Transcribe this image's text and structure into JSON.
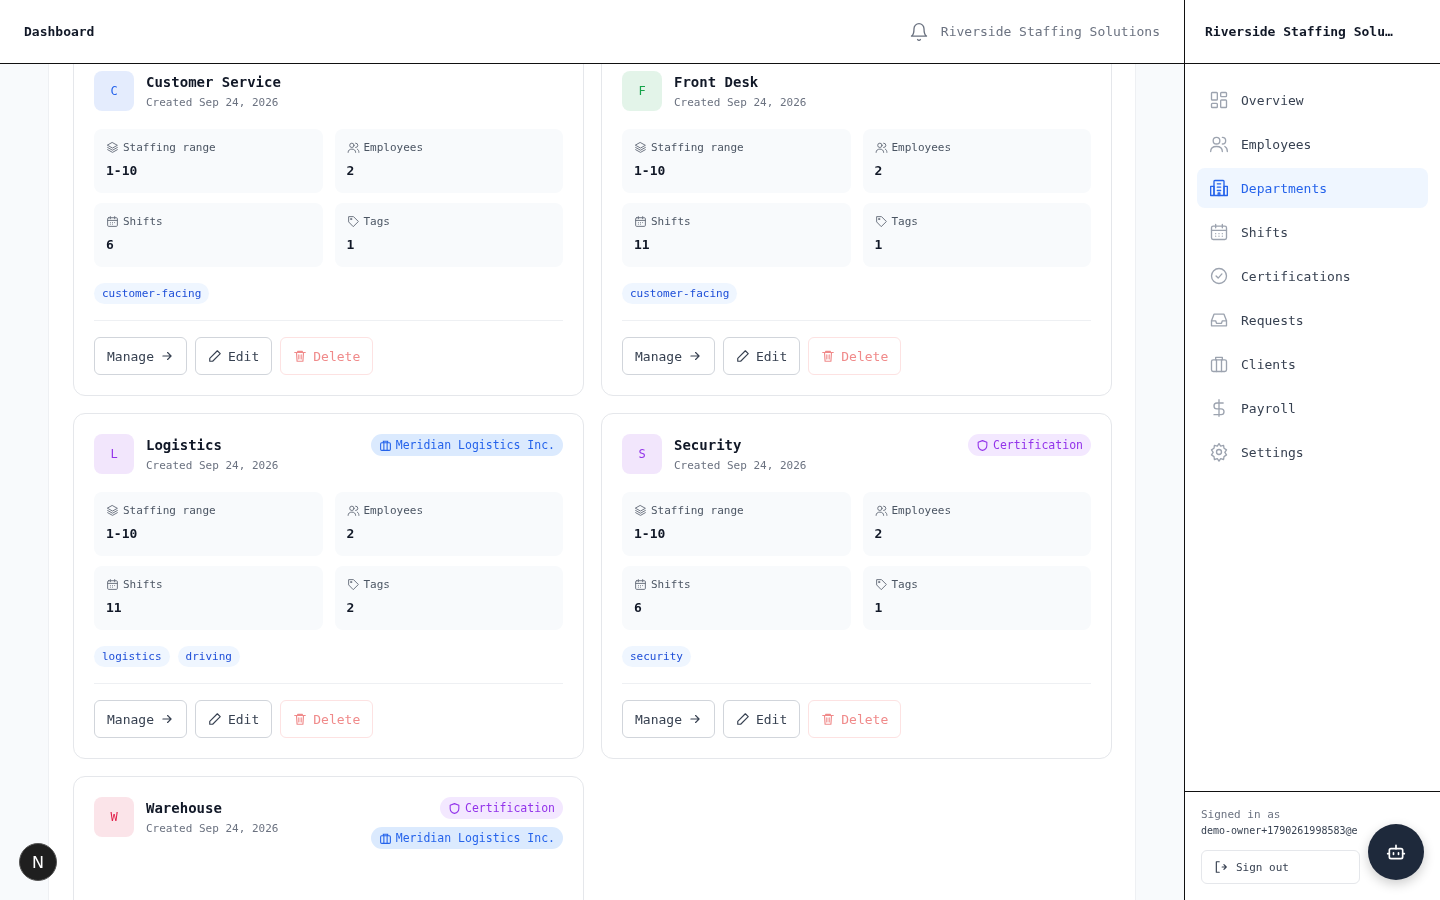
{
  "header": {
    "title": "Dashboard",
    "org": "Riverside Staffing Solutions"
  },
  "departments": [
    {
      "initial": "C",
      "color": "#2563eb",
      "name": "Customer Service",
      "created": "Created Sep 24, 2026",
      "stats": [
        {
          "label": "Staffing range",
          "value": "1-10"
        },
        {
          "label": "Employees",
          "value": "2"
        },
        {
          "label": "Shifts",
          "value": "6"
        },
        {
          "label": "Tags",
          "value": "1"
        }
      ],
      "tags": [
        "customer-facing"
      ],
      "actions": [
        "Manage",
        "Edit",
        "Delete"
      ]
    },
    {
      "initial": "F",
      "color": "#16a34a",
      "name": "Front Desk",
      "created": "Created Sep 24, 2026",
      "stats": [
        {
          "label": "Staffing range",
          "value": "1-10"
        },
        {
          "label": "Employees",
          "value": "2"
        },
        {
          "label": "Shifts",
          "value": "11"
        },
        {
          "label": "Tags",
          "value": "1"
        }
      ],
      "tags": [
        "customer-facing"
      ],
      "actions": [
        "Manage",
        "Edit",
        "Delete"
      ]
    },
    {
      "initial": "L",
      "color": "#9333ea",
      "name": "Logistics",
      "created": "Created Sep 24, 2026",
      "badges": [
        {
          "kind": "client",
          "label": "Meridian Logistics Inc."
        }
      ],
      "stats": [
        {
          "label": "Staffing range",
          "value": "1-10"
        },
        {
          "label": "Employees",
          "value": "2"
        },
        {
          "label": "Shifts",
          "value": "11"
        },
        {
          "label": "Tags",
          "value": "2"
        }
      ],
      "tags": [
        "logistics",
        "driving"
      ],
      "actions": [
        "Manage",
        "Edit",
        "Delete"
      ]
    },
    {
      "initial": "S",
      "color": "#9333ea",
      "name": "Security",
      "created": "Created Sep 24, 2026",
      "badges": [
        {
          "kind": "certification",
          "label": "Certification"
        }
      ],
      "stats": [
        {
          "label": "Staffing range",
          "value": "1-10"
        },
        {
          "label": "Employees",
          "value": "2"
        },
        {
          "label": "Shifts",
          "value": "6"
        },
        {
          "label": "Tags",
          "value": "1"
        }
      ],
      "tags": [
        "security"
      ],
      "actions": [
        "Manage",
        "Edit",
        "Delete"
      ]
    },
    {
      "initial": "W",
      "color": "#e11d48",
      "name": "Warehouse",
      "created": "Created Sep 24, 2026",
      "badges": [
        {
          "kind": "certification",
          "label": "Certification"
        },
        {
          "kind": "client",
          "label": "Meridian Logistics Inc."
        }
      ]
    }
  ],
  "sidebar": {
    "title": "Riverside Staffing Solu…",
    "items": [
      {
        "label": "Overview",
        "selected": false
      },
      {
        "label": "Employees",
        "selected": false
      },
      {
        "label": "Departments",
        "selected": true
      },
      {
        "label": "Shifts",
        "selected": false
      },
      {
        "label": "Certifications",
        "selected": false
      },
      {
        "label": "Requests",
        "selected": false
      },
      {
        "label": "Clients",
        "selected": false
      },
      {
        "label": "Payroll",
        "selected": false
      },
      {
        "label": "Settings",
        "selected": false
      }
    ],
    "signed_in_label": "Signed in as",
    "email": "demo-owner+1790261998583@e",
    "sign_out": "Sign out"
  },
  "dev_badge": "N"
}
